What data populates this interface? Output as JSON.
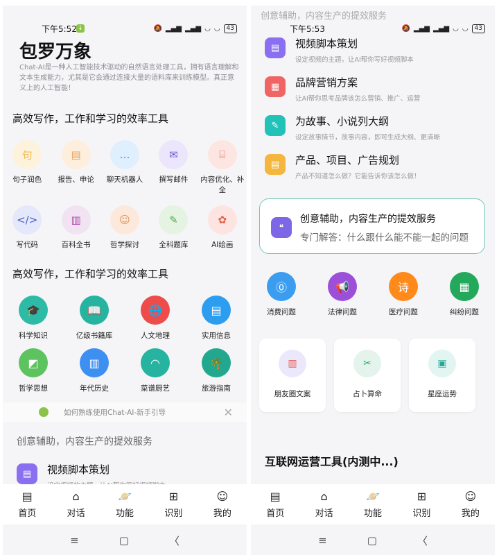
{
  "left": {
    "status": {
      "time": "下午5:52",
      "battery": "43"
    },
    "hero": {
      "title": "包罗万象",
      "desc": "Chat-AI是一种人工智能技术驱动的自然语言处理工具，拥有语言理解和文本生成能力，尤其是它会通过连接大量的语料库来训练模型。真正意义上的人工智能！"
    },
    "section1": {
      "title": "高效写作，工作和学习的效率工具",
      "items": [
        {
          "label": "句子润色",
          "glyph": "句",
          "bg": "#fdf2dc",
          "fg": "#f2b84b"
        },
        {
          "label": "报告、申论",
          "glyph": "▤",
          "bg": "#fdeedd",
          "fg": "#e8a25c"
        },
        {
          "label": "聊天机器人",
          "glyph": "…",
          "bg": "#e0effd",
          "fg": "#3a8ef0"
        },
        {
          "label": "撰写邮件",
          "glyph": "✉",
          "bg": "#ebe6fb",
          "fg": "#6b54d6"
        },
        {
          "label": "内容优化、补全",
          "glyph": "⌸",
          "bg": "#fde5e2",
          "fg": "#e96f5b"
        },
        {
          "label": "写代码",
          "glyph": "</>",
          "bg": "#e4e8fa",
          "fg": "#4a5cc8"
        },
        {
          "label": "百科全书",
          "glyph": "▥",
          "bg": "#f1e3f1",
          "fg": "#b04fb0"
        },
        {
          "label": "哲学探讨",
          "glyph": "☺",
          "bg": "#fce9dc",
          "fg": "#e58b45"
        },
        {
          "label": "全科题库",
          "glyph": "✎",
          "bg": "#e5f3e3",
          "fg": "#55aa4b"
        },
        {
          "label": "AI绘画",
          "glyph": "✿",
          "bg": "#fde4e0",
          "fg": "#e2604c"
        }
      ]
    },
    "section2": {
      "title": "高效写作，工作和学习的效率工具",
      "items": [
        {
          "label": "科学知识",
          "glyph": "🎓",
          "color": "#2dbba6"
        },
        {
          "label": "亿级书籍库",
          "glyph": "📖",
          "color": "#26b4a0"
        },
        {
          "label": "人文地理",
          "glyph": "🌐",
          "color": "#ee4b4b"
        },
        {
          "label": "实用信息",
          "glyph": "▤",
          "color": "#2d9df0"
        },
        {
          "label": "哲学思想",
          "glyph": "◩",
          "color": "#5cc35e"
        },
        {
          "label": "年代历史",
          "glyph": "▥",
          "color": "#3d8ff2"
        },
        {
          "label": "菜谱厨艺",
          "glyph": "◠",
          "color": "#26b4a0"
        },
        {
          "label": "旅游指南",
          "glyph": "🌴",
          "color": "#22a88e"
        }
      ]
    },
    "guide": {
      "text": "如何熟练使用Chat-AI-新手引导",
      "close": "✕"
    },
    "creative_head": "创意辅助，内容生产的提效服务",
    "list": [
      {
        "title": "视频脚本策划",
        "sub": "设定视频的主题，让AI帮你写好视频脚本",
        "color": "#8a6ff0",
        "glyph": "▤"
      }
    ]
  },
  "right": {
    "status": {
      "time": "下午5:53",
      "battery": "43"
    },
    "faded_head": "创意辅助，内容生产的提效服务",
    "list": [
      {
        "title": "视频脚本策划",
        "sub": "设定视频的主题，让AI帮你写好视频脚本",
        "color": "#8a6ff0",
        "glyph": "▤"
      },
      {
        "title": "品牌营销方案",
        "sub": "让AI帮你思考品牌该怎么营销、推广、运营",
        "color": "#f06464",
        "glyph": "▦"
      },
      {
        "title": "为故事、小说列大纲",
        "sub": "设定故事情节，故事内容，即可生成大纲、更清晰",
        "color": "#22c2b8",
        "glyph": "✎"
      },
      {
        "title": "产品、项目、广告规划",
        "sub": "产品不知道怎么做？它能告诉你该怎么做！",
        "color": "#f4b63c",
        "glyph": "▤"
      }
    ],
    "outline_card": {
      "title": "创意辅助，内容生产的提效服务",
      "sub": "专门解答：什么跟什么能不能一起的问题",
      "glyph": "❝"
    },
    "problems": [
      {
        "label": "消费问题",
        "glyph": "⓪",
        "color": "#3b9df0"
      },
      {
        "label": "法律问题",
        "glyph": "📢",
        "color": "#9c4fd9"
      },
      {
        "label": "医疗问题",
        "glyph": "诗",
        "color": "#ff8a1c"
      },
      {
        "label": "纠纷问题",
        "glyph": "▦",
        "color": "#23a85c"
      }
    ],
    "cards": [
      {
        "label": "朋友圈文案",
        "glyph": "▥",
        "bg": "#ece8fb",
        "fg": "#e05a4b"
      },
      {
        "label": "占卜算命",
        "glyph": "✂",
        "bg": "#e4f3ec",
        "fg": "#2ea66a"
      },
      {
        "label": "星座运势",
        "glyph": "▣",
        "bg": "#e2f5f1",
        "fg": "#26a894"
      }
    ],
    "tools_title": "互联网运营工具(内测中...)"
  },
  "tabs": [
    {
      "label": "首页",
      "glyph": "▤"
    },
    {
      "label": "对话",
      "glyph": "⌂"
    },
    {
      "label": "功能",
      "glyph": "🪐"
    },
    {
      "label": "识别",
      "glyph": "⊞"
    },
    {
      "label": "我的",
      "glyph": "☺"
    }
  ],
  "nav": {
    "menu": "≡",
    "home": "▢",
    "back": "〈"
  }
}
